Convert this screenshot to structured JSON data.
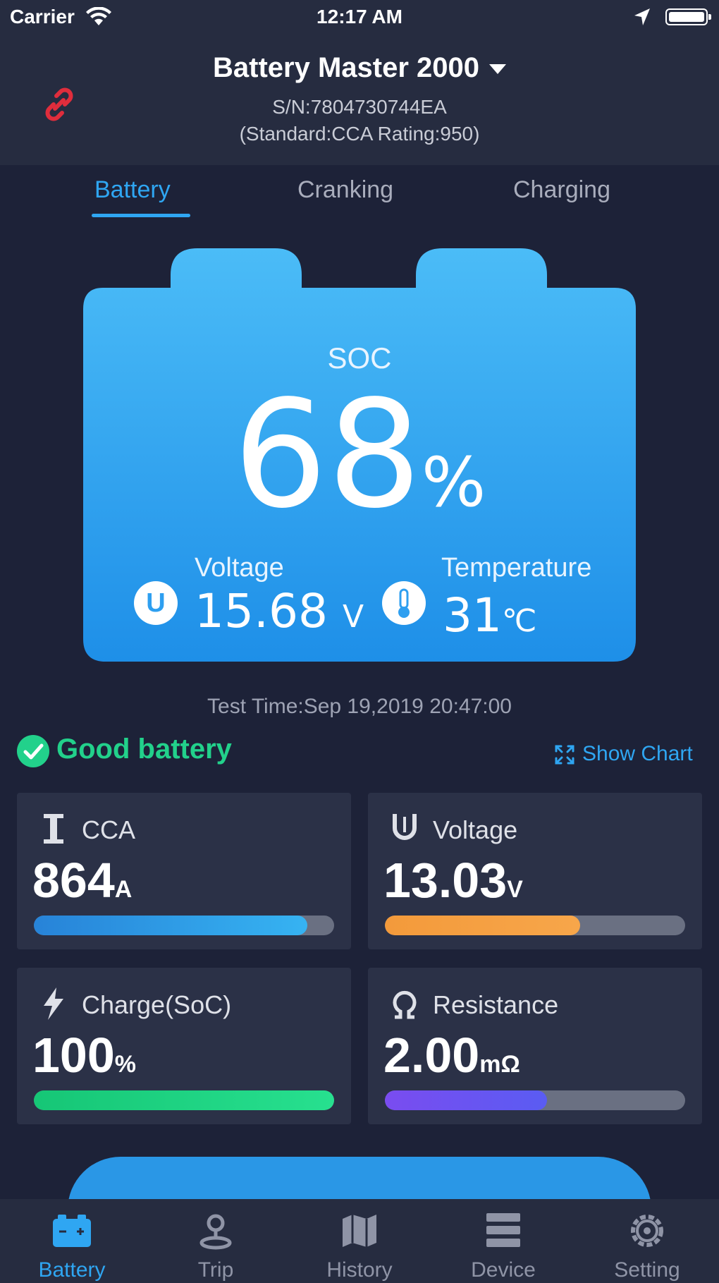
{
  "status_bar": {
    "carrier": "Carrier",
    "time": "12:17 AM"
  },
  "header": {
    "title": "Battery Master 2000",
    "serial": "S/N:7804730744EA",
    "standard": "(Standard:CCA  Rating:950)",
    "link_icon": "unlink-icon",
    "link_icon_color": "#e02d3c"
  },
  "tabs": [
    {
      "label": "Battery",
      "active": true
    },
    {
      "label": "Cranking",
      "active": false
    },
    {
      "label": "Charging",
      "active": false
    }
  ],
  "battery_card": {
    "soc_label": "SOC",
    "soc_value": "68",
    "soc_unit": "%",
    "voltage_label": "Voltage",
    "voltage_value": "15.68",
    "voltage_unit": "V",
    "voltage_icon_glyph": "U",
    "temperature_label": "Temperature",
    "temperature_value": "31",
    "temperature_unit": "℃",
    "gradient_top": "#46b9f6",
    "gradient_bottom": "#1e8fe8"
  },
  "test_time": "Test Time:Sep 19,2019 20:47:00",
  "result": {
    "text": "Good battery",
    "color": "#22d18b",
    "show_chart_label": "Show Chart"
  },
  "tiles": [
    {
      "label": "CCA",
      "value": "864",
      "unit": "A",
      "icon": "current-icon",
      "level": 0.91,
      "color_start": "#2783d8",
      "color_end": "#36b3f2"
    },
    {
      "label": "Voltage",
      "value": "13.03",
      "unit": "V",
      "icon": "voltage-icon",
      "level": 0.65,
      "color_start": "#f39a3b",
      "color_end": "#f7a64a"
    },
    {
      "label": "Charge(SoC)",
      "value": "100",
      "unit": "%",
      "icon": "bolt-icon",
      "level": 1.0,
      "color_start": "#16c676",
      "color_end": "#27e08f"
    },
    {
      "label": "Resistance",
      "value": "2.00",
      "unit": "mΩ",
      "icon": "ohm-icon",
      "level": 0.54,
      "color_start": "#7a4cf0",
      "color_end": "#5a5cf2"
    }
  ],
  "nav": [
    {
      "label": "Battery",
      "icon": "battery-icon",
      "active": true
    },
    {
      "label": "Trip",
      "icon": "trip-icon",
      "active": false
    },
    {
      "label": "History",
      "icon": "history-icon",
      "active": false
    },
    {
      "label": "Device",
      "icon": "device-icon",
      "active": false
    },
    {
      "label": "Setting",
      "icon": "gear-icon",
      "active": false
    }
  ]
}
